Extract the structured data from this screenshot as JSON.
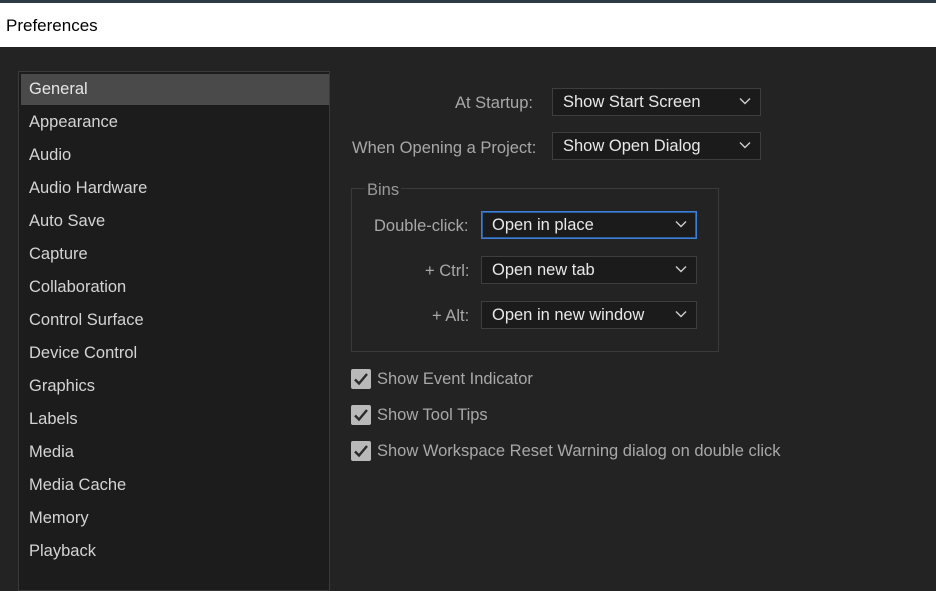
{
  "window": {
    "title": "Preferences"
  },
  "sidebar": {
    "items": [
      {
        "label": "General",
        "selected": true
      },
      {
        "label": "Appearance"
      },
      {
        "label": "Audio"
      },
      {
        "label": "Audio Hardware"
      },
      {
        "label": "Auto Save"
      },
      {
        "label": "Capture"
      },
      {
        "label": "Collaboration"
      },
      {
        "label": "Control Surface"
      },
      {
        "label": "Device Control"
      },
      {
        "label": "Graphics"
      },
      {
        "label": "Labels"
      },
      {
        "label": "Media"
      },
      {
        "label": "Media Cache"
      },
      {
        "label": "Memory"
      },
      {
        "label": "Playback"
      }
    ]
  },
  "general": {
    "startup": {
      "label": "At Startup:",
      "value": "Show Start Screen"
    },
    "opening_project": {
      "label": "When Opening a Project:",
      "value": "Show Open Dialog"
    },
    "bins": {
      "legend": "Bins",
      "double_click": {
        "label": "Double-click:",
        "value": "Open in place"
      },
      "ctrl": {
        "label": "+ Ctrl:",
        "value": "Open new tab"
      },
      "alt": {
        "label": "+ Alt:",
        "value": "Open in new window"
      }
    },
    "checkboxes": [
      {
        "label": "Show Event Indicator",
        "checked": true
      },
      {
        "label": "Show Tool Tips",
        "checked": true
      },
      {
        "label": "Show Workspace Reset Warning dialog on double click",
        "checked": true
      }
    ]
  },
  "icons": {
    "dropdown": "chevron-down-icon",
    "checkmark": "checkmark-icon"
  },
  "colors": {
    "background": "#232323",
    "sidebar_bg": "#1c1c1c",
    "selected_item": "#4a4a4a",
    "focus_border": "#3d7fd6"
  }
}
